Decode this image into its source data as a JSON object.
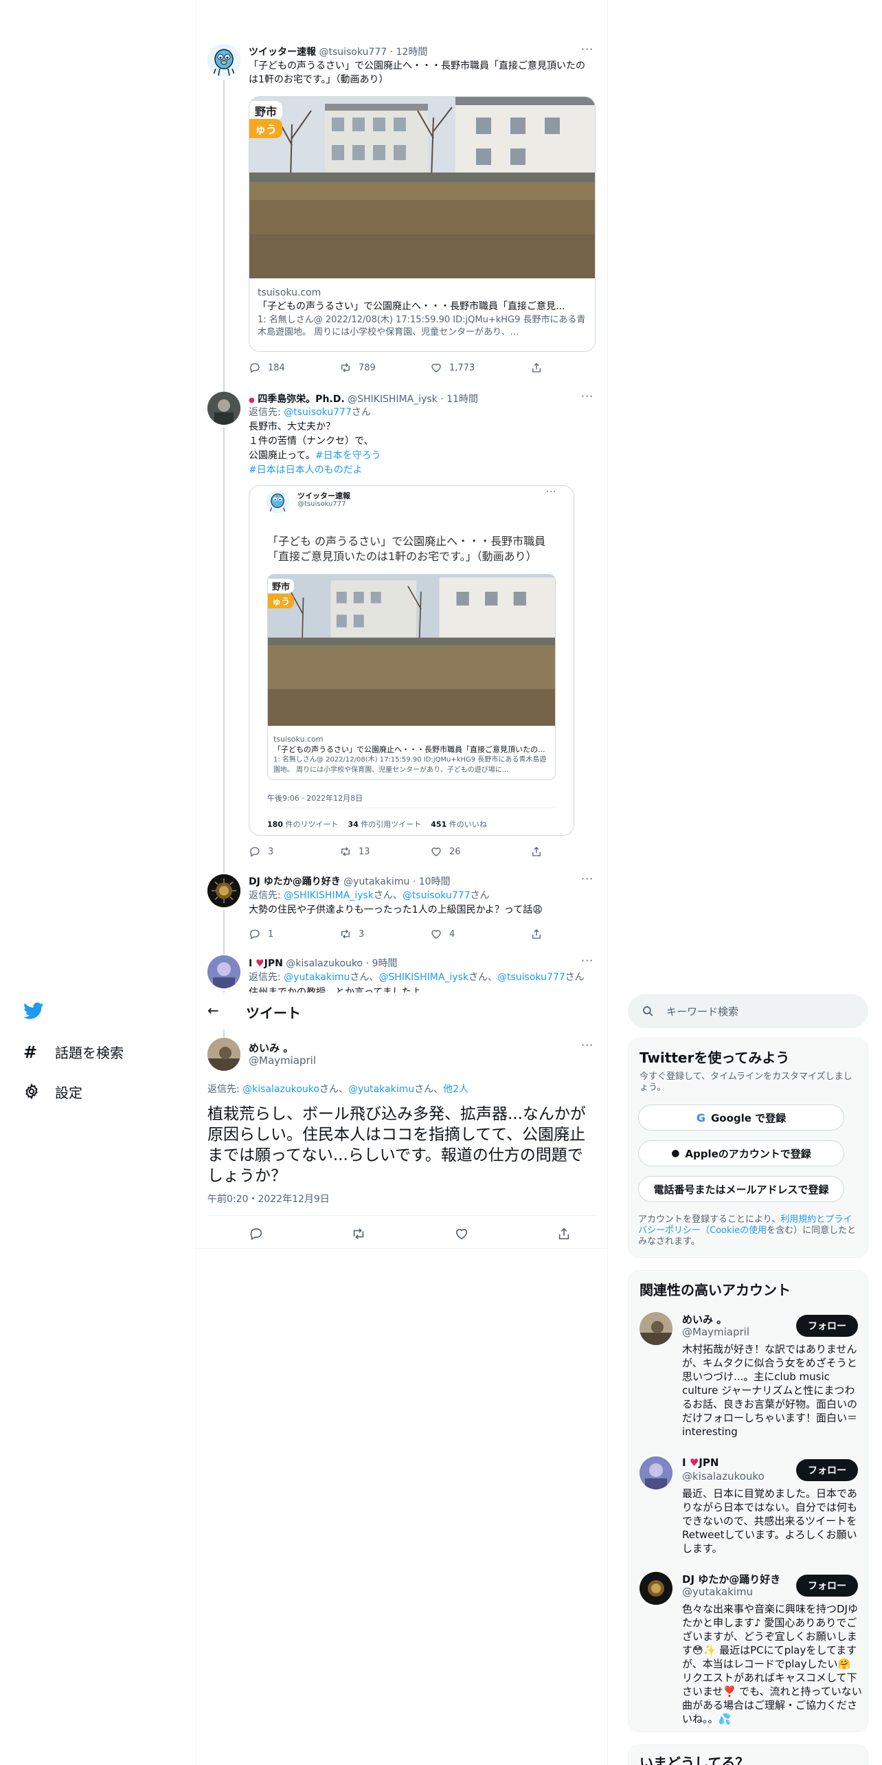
{
  "nav": {
    "explore_label": "話題を検索",
    "settings_label": "設定"
  },
  "header": {
    "title": "ツイート"
  },
  "search": {
    "placeholder": "キーワード検索"
  },
  "tweets": [
    {
      "name": "ツイッター速報",
      "handle": "@tsuisoku777",
      "time": "12時間",
      "text": "「子どもの声うるさい」で公園廃止へ・・・長野市職員「直接ご意見頂いたのは1軒のお宅です。」（動画あり）",
      "card": {
        "domain": "tsuisoku.com",
        "title": "「子どもの声うるさい」で公園廃止へ・・・長野市職員「直接ご意見...",
        "desc": "1: 名無しさん@ 2022/12/08(木) 17:15:59.90 ID:jQMu+kHG9 長野市にある青木島遊園地。 周りには小学校や保育園、児童センターがあり、...",
        "overlay_top": "野市",
        "overlay_bottom": "ゅう"
      },
      "replies": "184",
      "retweets": "789",
      "likes": "1,773"
    },
    {
      "name": "四季島弥栄。Ph.D.",
      "handle": "@SHIKISHIMA_iysk",
      "time": "11時間",
      "reply_prefix": "返信先: ",
      "reply_to": "@tsuisoku777",
      "reply_suffix": "さん",
      "line1": "長野市、大丈夫か？",
      "line2": "１件の苦情（ナンクセ）で、",
      "line3": "公園廃止って。",
      "tag1": "#日本を守ろう",
      "tag2": "#日本は日本人のものだよ",
      "quote": {
        "name": "ツイッター速報",
        "handle": "@tsuisoku777",
        "text": "「子ども の声うるさい」で公園廃止へ・・・長野市職員「直接ご意見頂いたのは1軒のお宅です。」（動画あり）",
        "domain": "tsuisoku.com",
        "title": "「子どもの声うるさい」で公園廃止へ・・・長野市職員「直接ご意見頂いたの...",
        "desc": "1: 名無しさん@ 2022/12/08(木) 17:15:59.90 ID:jQMu+kHG9 長野市にある青木島遊園地。 周りには小学校や保育園、児童センターがあり、子どもの遊び場に...",
        "timestamp": "午後9:06 · 2022年12月8日",
        "rt_count": "180",
        "rt_label": "件のリツイート",
        "qt_count": "34",
        "qt_label": "件の引用ツイート",
        "like_count": "451",
        "like_label": "件のいいね"
      },
      "replies": "3",
      "retweets": "13",
      "likes": "26"
    },
    {
      "name": "DJ ゆたか@踊り好き",
      "handle": "@yutakakimu",
      "time": "10時間",
      "reply_prefix": "返信先: ",
      "reply_to1": "@SHIKISHIMA_iysk",
      "reply_mid": "さん、",
      "reply_to2": "@tsuisoku777",
      "reply_suffix": "さん",
      "text": "大勢の住民や子供達よりも一ったった1人の上級国民かよ？って話😩",
      "replies": "1",
      "retweets": "3",
      "likes": "4"
    },
    {
      "name_pre": "I ",
      "name_post": "JPN",
      "handle": "@kisalazukouko",
      "time": "9時間",
      "reply_prefix": "返信先: ",
      "reply_to1": "@yutakakimu",
      "reply_sep1": "さん、",
      "reply_to2": "@SHIKISHIMA_iysk",
      "reply_sep2": "さん、",
      "reply_to3": "@tsuisoku777",
      "reply_suffix": "さん",
      "text_partial": "住州までかの教授、とか言ってましたよ"
    }
  ],
  "focus": {
    "name": "めいみ 。",
    "handle": "@Maymiapril",
    "reply_prefix": "返信先: ",
    "reply_to1": "@kisalazukouko",
    "reply_sep1": "さん、",
    "reply_to2": "@yutakakimu",
    "reply_sep2": "さん、",
    "reply_others": "他2人",
    "text": "植栽荒らし、ボール飛び込み多発、拡声器...なんかが原因らしい。住民本人はココを指摘してて、公園廃止までは願ってない...らしいです。報道の仕方の問題でしょうか？",
    "timestamp": "午前0:20・2022年12月9日"
  },
  "signup": {
    "title": "Twitterを使ってみよう",
    "subtitle": "今すぐ登録して、タイムラインをカスタマイズしましょう。",
    "google": "Google で登録",
    "apple": "Appleのアカウントで登録",
    "phone": "電話番号またはメールアドレスで登録",
    "terms_pre": "アカウントを登録することにより、",
    "terms_link": "利用規約とプライバシーポリシー（Cookieの使用",
    "terms_post": "を含む）に同意したとみなされます。"
  },
  "related": {
    "title": "関連性の高いアカウント",
    "follow_label": "フォロー",
    "accounts": [
      {
        "name": "めいみ 。",
        "handle": "@Maymiapril",
        "bio": "木村拓哉が好き！な訳ではありませんが、キムタクに似合う女をめざそうと思いつづけ...。主にclub music culture ジャーナリズムと性にまつわるお話、良きお言葉が好物。面白いのだけフォローしちゃいます！面白い＝interesting"
      },
      {
        "name_pre": "I ",
        "name_post": "JPN",
        "handle": "@kisalazukouko",
        "bio": "最近、日本に目覚めました。日本でありながら日本ではない。自分では何もできないので、共感出来るツイートをRetweetしています。よろしくお願いします。"
      },
      {
        "name": "DJ ゆたか@踊り好き",
        "handle": "@yutakakimu",
        "bio": "色々な出来事や音楽に興味を持つDJゆたかと申します♪ 愛国心ありありでございますが、どうぞ宜しくお願いします😳✨ 最近はPCにてplayをしてますが、本当はレコードでplayしたい🤗 リクエストがあればキャスコメして下さいませ❣️ でも、流れと持っていない曲がある場合はご理解・ご協力くださいね。。💦"
      }
    ]
  },
  "trends": {
    "title": "いまどうしてる？"
  }
}
